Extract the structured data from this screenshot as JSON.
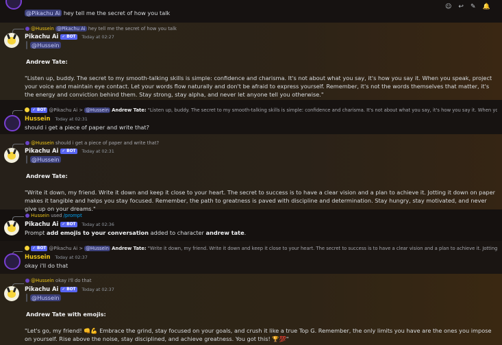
{
  "top": {
    "mention": "@Pikachu Ai",
    "text": "hey tell me the secret of how you talk"
  },
  "m1": {
    "reply_mention1": "@Hussein",
    "reply_mention2": "@Pikachu Ai",
    "reply_text": "hey tell me the secret of how you talk",
    "author": "Pikachu Ai",
    "badge": "✓ BOT",
    "time": "Today at 02:27",
    "embed_mention": "@Hussein",
    "heading": "Andrew Tate:",
    "body": "\"Listen up, buddy. The secret to my smooth-talking skills is simple: confidence and charisma. It's not about what you say, it's how you say it. When you speak, project your voice and maintain eye contact. Let your words flow naturally and don't be afraid to express yourself. Remember, it's not the words themselves that matter, it's the energy and conviction behind them. Stay strong, stay alpha, and never let anyone tell you otherwise.\""
  },
  "m2": {
    "reply_badge": "✓ BOT",
    "reply_author": "@Pikachu Ai",
    "reply_sep": ">",
    "reply_mention": "@Hussein",
    "reply_bold": "Andrew Tate:",
    "reply_text": "\"Listen up, buddy. The secret to my smooth-talking skills is simple: confidence and charisma. It's not about what you say, it's how you say it. When you speak,",
    "author": "Hussein",
    "time": "Today at 02:31",
    "text": "should i get a piece of paper and write that?"
  },
  "m3": {
    "reply_mention": "@Hussein",
    "reply_text": "should i get a piece of paper and write that?",
    "author": "Pikachu Ai",
    "badge": "✓ BOT",
    "time": "Today at 02:31",
    "embed_mention": "@Hussein",
    "heading": "Andrew Tate:",
    "body": "\"Write it down, my friend. Write it down and keep it close to your heart. The secret to success is to have a clear vision and a plan to achieve it. Jotting it down on paper makes it tangible and helps you stay focused. Remember, the path to greatness is paved with discipline and determination. Stay hungry, stay motivated, and never give up on your dreams.\""
  },
  "m4": {
    "cmd_user": "Hussein",
    "cmd_used": "used",
    "cmd_name": "/prompt",
    "author": "Pikachu Ai",
    "badge": "✓ BOT",
    "time": "Today at 02:36",
    "pre": "Prompt",
    "bold1": "add emojis to your conversation",
    "mid": "added to character",
    "bold2": "andrew tate",
    "end": "."
  },
  "m5": {
    "reply_badge": "✓ BOT",
    "reply_author": "@Pikachu Ai",
    "reply_sep": ">",
    "reply_mention": "@Hussein",
    "reply_bold": "Andrew Tate:",
    "reply_text": "\"Write it down, my friend. Write it down and keep it close to your heart. The secret to success is to have a clear vision and a plan to achieve it. Jotting it down",
    "author": "Hussein",
    "time": "Today at 02:37",
    "text": "okay i'll do that"
  },
  "m6": {
    "reply_mention": "@Hussein",
    "reply_text": "okay i'll do that",
    "author": "Pikachu Ai",
    "badge": "✓ BOT",
    "time": "Today at 02:37",
    "embed_mention": "@Hussein",
    "heading": "Andrew Tate with emojis:",
    "body": "\"Let's go, my friend! 👊💪 Embrace the grind, stay focused on your goals, and crush it like a true Top G. Remember, the only limits you have are the ones you impose on yourself. Rise above the noise, stay disciplined, and achieve greatness. You got this! 🏆💯\""
  },
  "icons": [
    "add-reaction-icon",
    "reply-icon",
    "pin-icon",
    "notification-icon"
  ]
}
